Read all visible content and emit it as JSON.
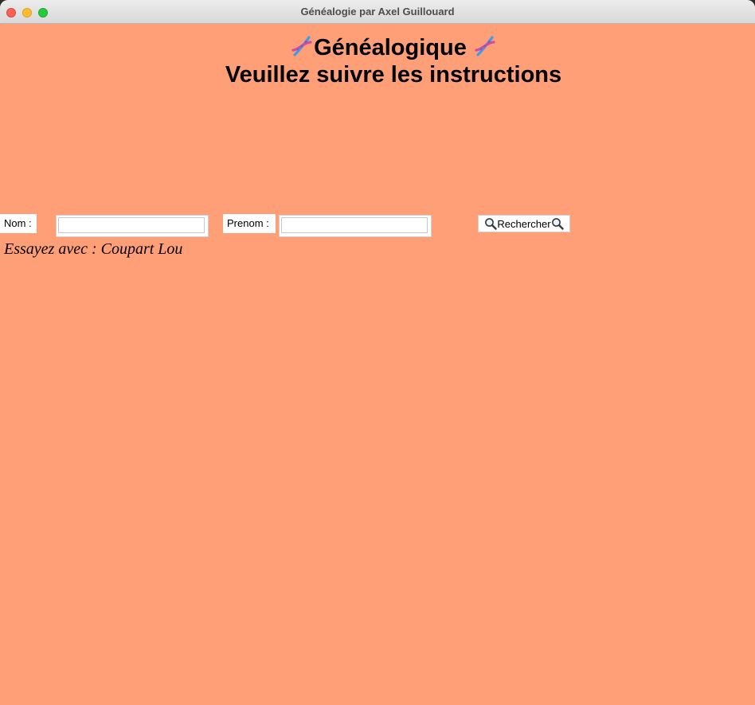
{
  "window": {
    "title": "Généalogie par Axel Guillouard"
  },
  "header": {
    "title": "Généalogique ",
    "title_icon": "dna-icon",
    "subtitle": "Veuillez suivre les instructions"
  },
  "form": {
    "nom_label": "Nom :",
    "nom_value": "",
    "prenom_label": "Prenom :",
    "prenom_value": "",
    "search_label": "Rechercher",
    "search_icon": "magnifier-icon"
  },
  "hint": {
    "text": "Essayez avec : Coupart Lou"
  },
  "colors": {
    "background": "#ff9f78",
    "field_background": "#ffffff"
  }
}
